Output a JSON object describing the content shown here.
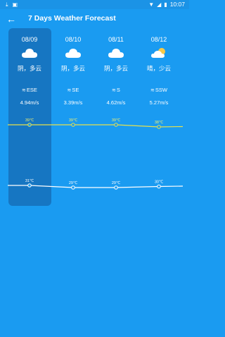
{
  "status_bar": {
    "time": "10:07"
  },
  "header": {
    "title": "7 Days Weather Forecast"
  },
  "colors": {
    "background": "#1a9bf1",
    "selected": "#1676c2",
    "high_line": "#e5e04d",
    "low_line": "#ffffff"
  },
  "days": [
    {
      "date": "08/09",
      "icon": "cloudy-icon",
      "condition": "阴，多云",
      "wind_dir": "ESE",
      "wind_speed": "4.94m/s",
      "high": "39℃",
      "low": "31℃"
    },
    {
      "date": "08/10",
      "icon": "cloudy-icon",
      "condition": "阴，多云",
      "wind_dir": "SE",
      "wind_speed": "3.39m/s",
      "high": "39℃",
      "low": "29℃"
    },
    {
      "date": "08/11",
      "icon": "cloudy-icon",
      "condition": "阴，多云",
      "wind_dir": "S",
      "wind_speed": "4.62m/s",
      "high": "39℃",
      "low": "29℃"
    },
    {
      "date": "08/12",
      "icon": "partly-sunny-icon",
      "condition": "晴，少云",
      "wind_dir": "SSW",
      "wind_speed": "5.27m/s",
      "high": "38℃",
      "low": "30℃"
    }
  ],
  "chart_data": {
    "type": "line",
    "categories": [
      "08/09",
      "08/10",
      "08/11",
      "08/12"
    ],
    "series": [
      {
        "values": [
          39,
          39,
          39,
          38
        ]
      },
      {
        "values": [
          31,
          29,
          29,
          30
        ]
      }
    ]
  }
}
